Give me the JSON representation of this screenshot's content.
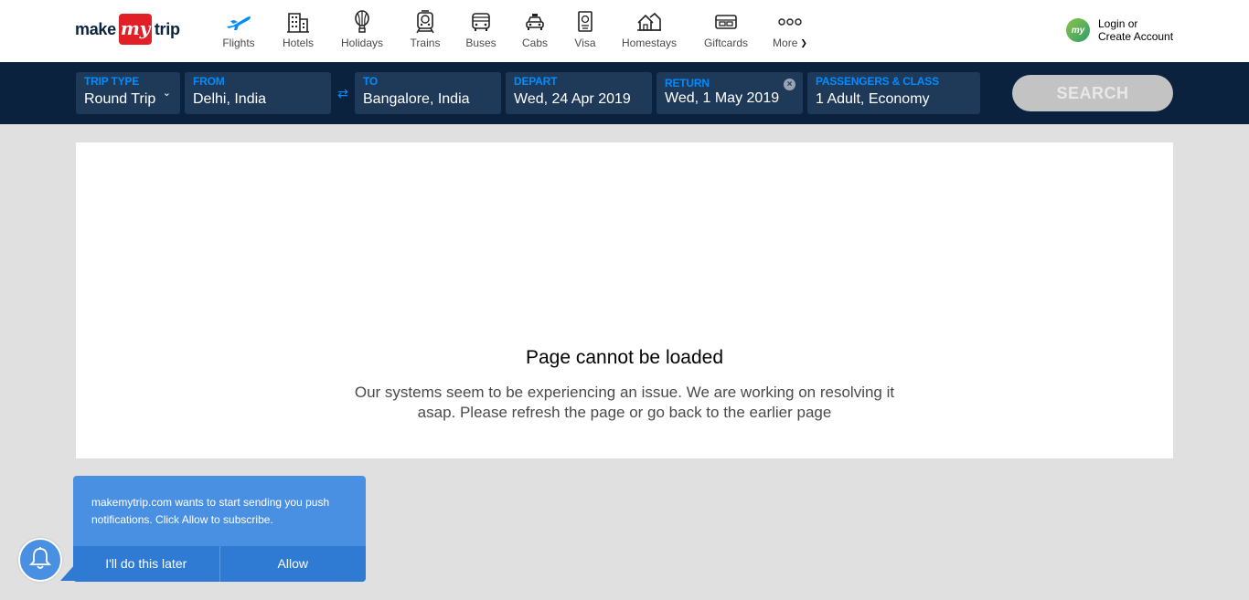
{
  "logo": {
    "make": "make",
    "my": "my",
    "trip": "trip"
  },
  "nav": [
    {
      "label": "Flights",
      "icon": "flight-icon",
      "active": true
    },
    {
      "label": "Hotels",
      "icon": "hotel-icon"
    },
    {
      "label": "Holidays",
      "icon": "balloon-icon"
    },
    {
      "label": "Trains",
      "icon": "train-icon"
    },
    {
      "label": "Buses",
      "icon": "bus-icon"
    },
    {
      "label": "Cabs",
      "icon": "cab-icon"
    },
    {
      "label": "Visa",
      "icon": "passport-icon"
    },
    {
      "label": "Homestays",
      "icon": "homestay-icon"
    },
    {
      "label": "Giftcards",
      "icon": "giftcard-icon"
    },
    {
      "label": "More",
      "icon": "more-dots-icon"
    }
  ],
  "login": {
    "line1": "Login or",
    "line2": "Create Account",
    "avatar": "my"
  },
  "search": {
    "trip_type": {
      "label": "TRIP TYPE",
      "value": "Round Trip"
    },
    "from": {
      "label": "FROM",
      "value": "Delhi, India"
    },
    "to": {
      "label": "TO",
      "value": "Bangalore, India"
    },
    "depart": {
      "label": "DEPART",
      "value": "Wed, 24 Apr 2019"
    },
    "return": {
      "label": "RETURN",
      "value": "Wed, 1 May 2019"
    },
    "passengers": {
      "label": "PASSENGERS & CLASS",
      "value": "1 Adult, Economy"
    },
    "button": "SEARCH"
  },
  "error": {
    "title": "Page cannot be loaded",
    "message": "Our systems seem to be experiencing an issue. We are working on resolving it asap. Please refresh the page or go back to the earlier page"
  },
  "push": {
    "message": "makemytrip.com wants to start sending you push notifications. Click Allow to subscribe.",
    "later": "I'll do this later",
    "allow": "Allow"
  },
  "colors": {
    "header_bg": "#ffffff",
    "search_bar_bg": "#0a223d",
    "field_bg": "#1f3a58",
    "field_label": "#008cff",
    "brand_red": "#e01f26",
    "notif_blue": "#4a90e2",
    "page_bg": "#e0e0e0"
  }
}
